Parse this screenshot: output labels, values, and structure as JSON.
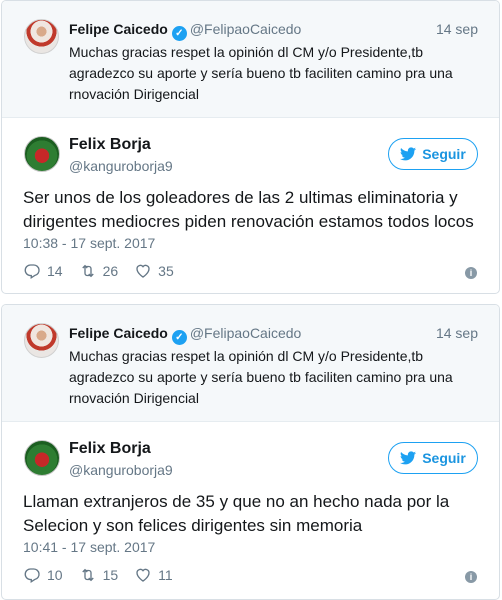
{
  "tweets": [
    {
      "quoted": {
        "name": "Felipe Caicedo",
        "handle": "@FelipaoCaicedo",
        "date": "14 sep",
        "text": "Muchas gracias respet la opinión dl CM y/o Presidente,tb agradezco su aporte y sería bueno tb faciliten camino pra una rnovación Dirigencial"
      },
      "main": {
        "name": "Felix Borja",
        "handle": "@kanguroborja9",
        "follow_label": "Seguir",
        "text": "Ser unos de los goleadores de las 2 ultimas eliminatoria y dirigentes mediocres piden renovación estamos todos locos",
        "timestamp": "10:38 - 17 sept. 2017",
        "replies": "14",
        "retweets": "26",
        "likes": "35"
      }
    },
    {
      "quoted": {
        "name": "Felipe Caicedo",
        "handle": "@FelipaoCaicedo",
        "date": "14 sep",
        "text": "Muchas gracias respet la opinión dl CM y/o Presidente,tb agradezco su aporte y sería bueno tb faciliten camino pra una rnovación Dirigencial"
      },
      "main": {
        "name": "Felix Borja",
        "handle": "@kanguroborja9",
        "follow_label": "Seguir",
        "text": "Llaman extranjeros de 35 y que no an hecho nada por la Selecion y son felices dirigentes sin memoria",
        "timestamp": "10:41 - 17 sept. 2017",
        "replies": "10",
        "retweets": "15",
        "likes": "11"
      }
    }
  ],
  "icons": {
    "verified": "verified-badge-icon",
    "follow": "twitter-bird-icon",
    "reply": "reply-icon",
    "retweet": "retweet-icon",
    "like": "heart-icon",
    "info": "info-icon"
  },
  "colors": {
    "brand_blue": "#1da1f2",
    "muted_text": "#657786",
    "quoted_bg": "#f5f8fa",
    "border": "#d8dfe5"
  }
}
